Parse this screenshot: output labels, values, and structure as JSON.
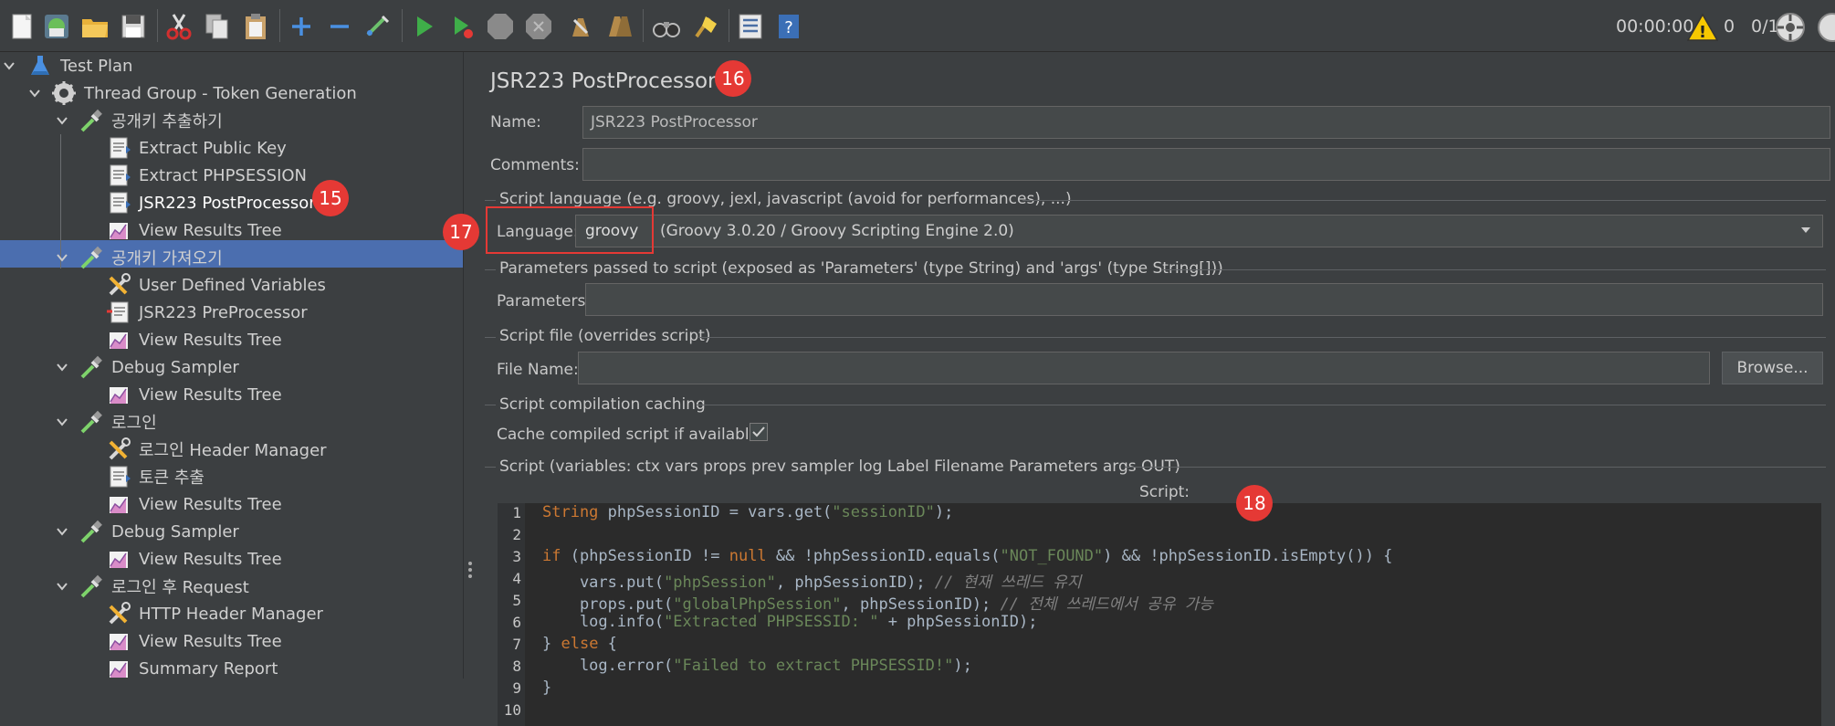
{
  "toolbar": {
    "icons": [
      "new-icon",
      "templates-icon",
      "open-icon",
      "save-icon",
      "cut-icon",
      "copy-icon",
      "paste-icon",
      "expand-icon",
      "collapse-icon",
      "toggle-icon",
      "start-icon",
      "start-no-pause-icon",
      "stop-icon",
      "shutdown-icon",
      "clear-icon",
      "clear-all-icon",
      "search-icon",
      "reset-search-icon",
      "function-helper-icon",
      "help-icon"
    ],
    "timer": "00:00:00",
    "warning_count": "0",
    "threads": "0/1"
  },
  "tree": {
    "items": [
      {
        "label": "Test Plan",
        "icon": "flask-icon"
      },
      {
        "label": "Thread Group - Token Generation",
        "icon": "gear-icon"
      },
      {
        "label": "공개키 추출하기",
        "icon": "pipette-icon"
      },
      {
        "label": "Extract Public Key",
        "icon": "extractor-icon"
      },
      {
        "label": "Extract PHPSESSION",
        "icon": "extractor-icon"
      },
      {
        "label": "JSR223 PostProcessor",
        "icon": "extractor-icon"
      },
      {
        "label": "View Results Tree",
        "icon": "listener-chart-icon"
      },
      {
        "label": "공개키 가져오기",
        "icon": "pipette-icon"
      },
      {
        "label": "User Defined Variables",
        "icon": "wrench-icon"
      },
      {
        "label": "JSR223 PreProcessor",
        "icon": "preprocessor-icon"
      },
      {
        "label": "View Results Tree",
        "icon": "listener-chart-icon"
      },
      {
        "label": "Debug Sampler",
        "icon": "pipette-icon"
      },
      {
        "label": "View Results Tree",
        "icon": "listener-chart-icon"
      },
      {
        "label": "로그인",
        "icon": "pipette-icon"
      },
      {
        "label": "로그인 Header Manager",
        "icon": "wrench-icon"
      },
      {
        "label": "토큰 추출",
        "icon": "extractor-icon"
      },
      {
        "label": "View Results Tree",
        "icon": "listener-chart-icon"
      },
      {
        "label": "Debug Sampler",
        "icon": "pipette-icon"
      },
      {
        "label": "View Results Tree",
        "icon": "listener-chart-icon"
      },
      {
        "label": "로그인 후 Request",
        "icon": "pipette-icon"
      },
      {
        "label": "HTTP Header Manager",
        "icon": "wrench-icon"
      },
      {
        "label": "View Results Tree",
        "icon": "listener-chart-icon"
      },
      {
        "label": "Summary Report",
        "icon": "listener-chart-icon"
      }
    ],
    "selected_index": 5
  },
  "badges": {
    "b15": "15",
    "b16": "16",
    "b17": "17",
    "b18": "18"
  },
  "main": {
    "title": "JSR223 PostProcessor",
    "name_label": "Name:",
    "name_value": "JSR223 PostProcessor",
    "comments_label": "Comments:",
    "comments_value": "",
    "lang_section": "Script language (e.g. groovy, jexl, javascript (avoid for performances), ...)",
    "lang_label": "Language:",
    "lang_value": "groovy",
    "lang_engine": "(Groovy 3.0.20 / Groovy Scripting Engine 2.0)",
    "params_section": "Parameters passed to script (exposed as 'Parameters' (type String) and 'args' (type String[]))",
    "params_label": "Parameters:",
    "params_value": "",
    "file_section": "Script file (overrides script)",
    "file_label": "File Name:",
    "file_value": "",
    "browse_label": "Browse...",
    "cache_section": "Script compilation caching",
    "cache_label": "Cache compiled script if available:",
    "cache_checked": true,
    "script_section": "Script (variables: ctx vars props prev sampler log Label Filename Parameters args OUT)",
    "script_label": "Script:"
  },
  "script_lines": [
    "String phpSessionID = vars.get(\"sessionID\");",
    "",
    "if (phpSessionID != null && !phpSessionID.equals(\"NOT_FOUND\") && !phpSessionID.isEmpty()) {",
    "    vars.put(\"phpSession\", phpSessionID); // 현재 쓰레드 유지",
    "    props.put(\"globalPhpSession\", phpSessionID); // 전체 쓰레드에서 공유 가능",
    "    log.info(\"Extracted PHPSESSID: \" + phpSessionID);",
    "} else {",
    "    log.error(\"Failed to extract PHPSESSID!\");",
    "}",
    ""
  ],
  "line_numbers": [
    "1",
    "2",
    "3",
    "4",
    "5",
    "6",
    "7",
    "8",
    "9",
    "10"
  ]
}
